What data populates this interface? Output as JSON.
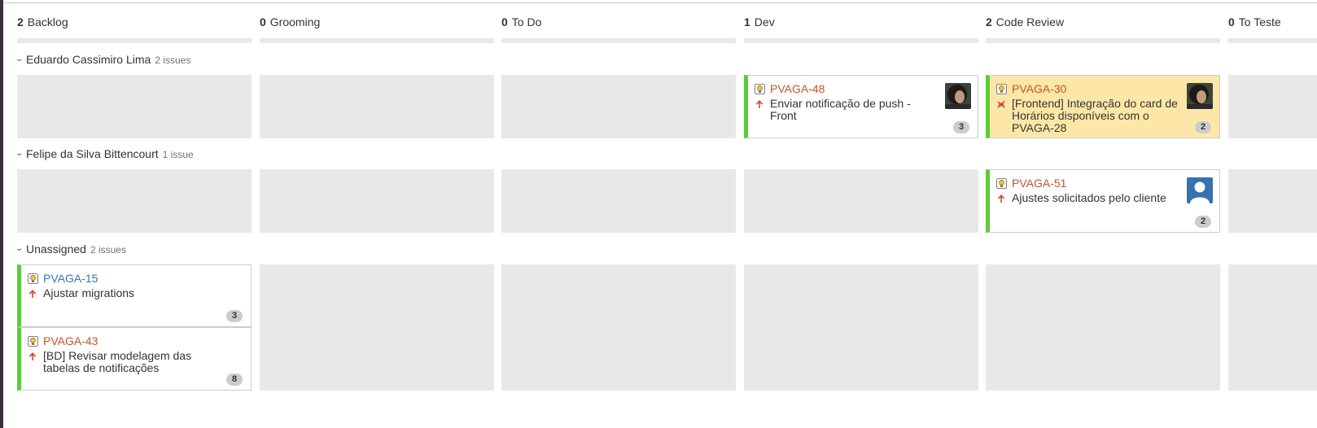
{
  "columns": [
    {
      "count": "2",
      "name": "Backlog"
    },
    {
      "count": "0",
      "name": "Grooming"
    },
    {
      "count": "0",
      "name": "To Do"
    },
    {
      "count": "1",
      "name": "Dev"
    },
    {
      "count": "2",
      "name": "Code Review"
    },
    {
      "count": "0",
      "name": "To Teste"
    }
  ],
  "swimlanes": [
    {
      "name": "Eduardo Cassimiro Lima",
      "issues": "2 issues"
    },
    {
      "name": "Felipe da Silva Bittencourt",
      "issues": "1 issue"
    },
    {
      "name": "Unassigned",
      "issues": "2 issues"
    }
  ],
  "cards": {
    "pvaga48": {
      "key": "PVAGA-48",
      "summary": "Enviar notificação de push - Front",
      "badge": "3",
      "priority": "high-priority-icon",
      "avatar": "user-photo-avatar"
    },
    "pvaga30": {
      "key": "PVAGA-30",
      "summary": "[Frontend] Integração do card de Horários disponíveis com o PVAGA-28",
      "badge": "2",
      "priority": "flag-icon",
      "avatar": "user-photo-avatar"
    },
    "pvaga51": {
      "key": "PVAGA-51",
      "summary": "Ajustes solicitados pelo cliente",
      "badge": "2",
      "priority": "high-priority-icon",
      "avatar": "default-user-avatar"
    },
    "pvaga15": {
      "key": "PVAGA-15",
      "summary": "Ajustar migrations",
      "badge": "3",
      "priority": "high-priority-icon"
    },
    "pvaga43": {
      "key": "PVAGA-43",
      "summary": "[BD] Revisar modelagem das tabelas de notificações",
      "badge": "8",
      "priority": "high-priority-icon"
    }
  },
  "colors": {
    "card_border": "#5ccc3c",
    "flagged_card": "#fde7a8",
    "issue_key": "#c1552d",
    "issue_key_link": "#3b73af",
    "cell_background": "#e8e8e8"
  }
}
